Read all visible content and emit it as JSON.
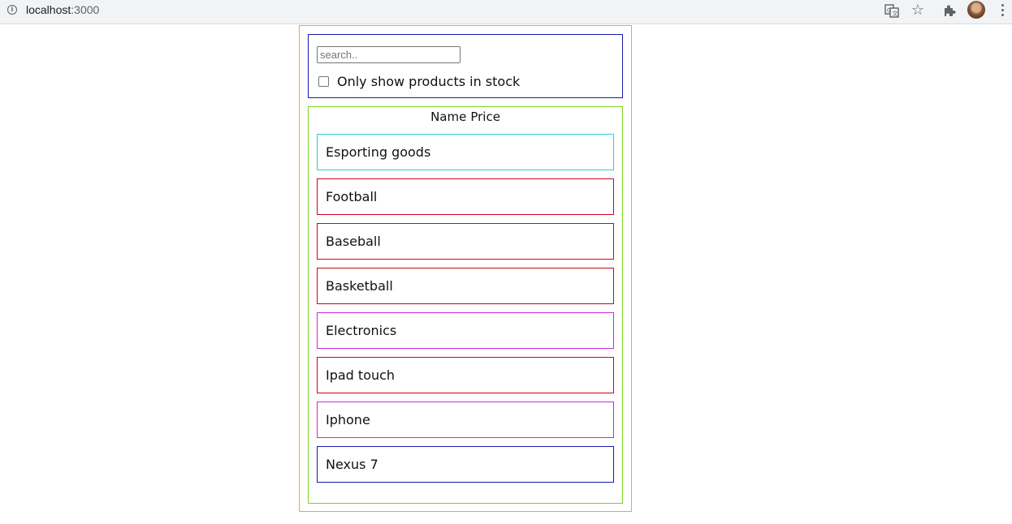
{
  "browser": {
    "url_host": "localhost",
    "url_port": ":3000",
    "icons": [
      "info-icon",
      "translate-icon",
      "star-icon",
      "extensions-icon",
      "avatar",
      "menu-icon"
    ]
  },
  "search": {
    "placeholder": "search..",
    "value": "",
    "stock_label": "Only show products in stock",
    "stock_checked": false
  },
  "table": {
    "header_name": "Name",
    "header_price": "Price",
    "rows": [
      {
        "label": "Esporting goods",
        "kind": "category",
        "border_color": "#2ad2d8"
      },
      {
        "label": "Football",
        "kind": "product",
        "border_color": "#d0021b"
      },
      {
        "label": "Baseball",
        "kind": "product",
        "border_color": "#d0021b"
      },
      {
        "label": "Basketball",
        "kind": "product",
        "border_color": "#d0021b"
      },
      {
        "label": "Electronics",
        "kind": "category",
        "border_color": "#c82ad8"
      },
      {
        "label": "Ipad touch",
        "kind": "product",
        "border_color": "#d0021b"
      },
      {
        "label": "Iphone",
        "kind": "product",
        "border_color": "#c82ad8"
      },
      {
        "label": "Nexus 7",
        "kind": "product",
        "border_color": "#1a1aa6"
      }
    ]
  },
  "colors": {
    "app_border": "#f5a623",
    "search_border": "#1a1aa6",
    "table_border": "#7ed321"
  }
}
